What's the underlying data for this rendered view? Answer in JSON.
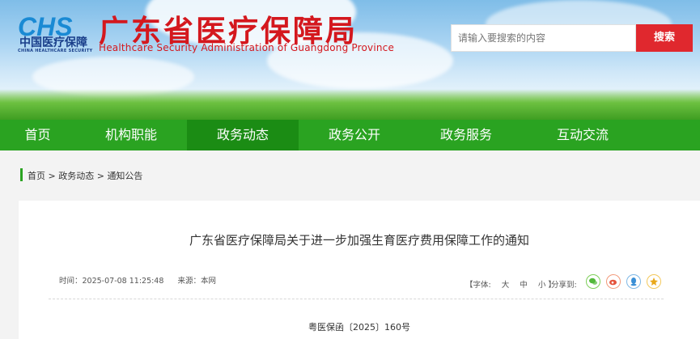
{
  "header": {
    "logo_mark": "CHS",
    "logo_cn": "中国医疗保障",
    "logo_en": "CHINA HEALTHCARE SECURITY",
    "title": "广东省医疗保障局",
    "subtitle": "Healthcare Security Administration of Guangdong Province"
  },
  "search": {
    "placeholder": "请输入要搜索的内容",
    "button_label": "搜索"
  },
  "nav": {
    "items": [
      {
        "label": "首页"
      },
      {
        "label": "机构职能"
      },
      {
        "label": "政务动态"
      },
      {
        "label": "政务公开"
      },
      {
        "label": "政务服务"
      },
      {
        "label": "互动交流"
      }
    ],
    "active": "政务动态"
  },
  "breadcrumb": {
    "home": "首页",
    "sep": ">",
    "level1": "政务动态",
    "level2": "通知公告"
  },
  "article": {
    "title": "广东省医疗保障局关于进一步加强生育医疗费用保障工作的通知",
    "time": "时间：2025-07-08 11:25:48",
    "source": "来源：本网",
    "font_label": "【字体:",
    "font_large": "大",
    "font_medium": "中",
    "font_small": "小",
    "font_close": "】",
    "share_label": "分享到:",
    "doc_number": "粤医保函〔2025〕160号"
  },
  "icons": {
    "share": [
      "wechat-icon",
      "weibo-icon",
      "qq-icon",
      "qzone-icon"
    ]
  },
  "colors": {
    "brand_red": "#d4181e",
    "nav_green": "#2aa321",
    "nav_active": "#1b8c14",
    "search_button": "#e0282e"
  }
}
